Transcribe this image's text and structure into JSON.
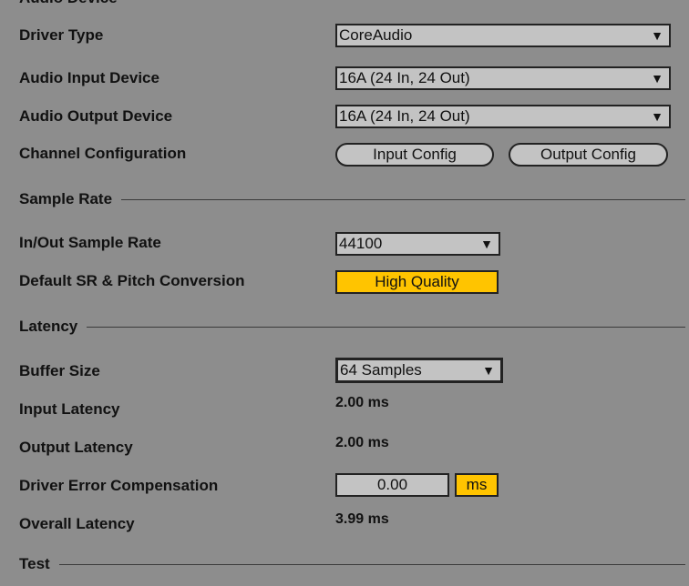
{
  "section_audio_device": "Audio Device",
  "driver_type": {
    "label": "Driver Type",
    "value": "CoreAudio"
  },
  "audio_input_device": {
    "label": "Audio Input Device",
    "value": "16A (24 In, 24 Out)"
  },
  "audio_output_device": {
    "label": "Audio Output Device",
    "value": "16A (24 In, 24 Out)"
  },
  "channel_configuration": {
    "label": "Channel Configuration",
    "input_button": "Input Config",
    "output_button": "Output Config"
  },
  "section_sample_rate": "Sample Rate",
  "sample_rate": {
    "label": "In/Out Sample Rate",
    "value": "44100"
  },
  "sr_conversion": {
    "label": "Default SR & Pitch Conversion",
    "value": "High Quality"
  },
  "section_latency": "Latency",
  "buffer_size": {
    "label": "Buffer Size",
    "value": "64 Samples"
  },
  "input_latency": {
    "label": "Input Latency",
    "value": "2.00 ms"
  },
  "output_latency": {
    "label": "Output Latency",
    "value": "2.00 ms"
  },
  "driver_error_compensation": {
    "label": "Driver Error Compensation",
    "value": "0.00",
    "unit": "ms"
  },
  "overall_latency": {
    "label": "Overall Latency",
    "value": "3.99 ms"
  },
  "section_test": "Test",
  "dropdown_arrow": "▼",
  "colors": {
    "background": "#8d8d8d",
    "accent": "#ffc400",
    "control": "#c3c3c3"
  }
}
